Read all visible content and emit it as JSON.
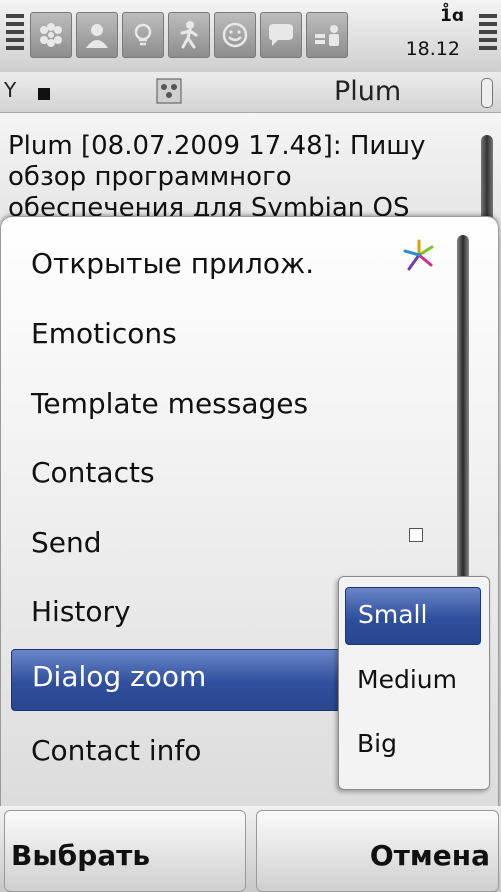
{
  "status": {
    "net_indicator": "1̊ɑ",
    "clock": "18.12",
    "tab_icons": [
      "contacts-group-icon",
      "person-icon",
      "lightbulb-icon",
      "running-person-icon",
      "smiley-icon",
      "speech-bubble-icon",
      "user-card-icon"
    ]
  },
  "titlebar": {
    "title": "Plum"
  },
  "chat": {
    "message": "Plum [08.07.2009 17.48]: Пишу обзор программного обеспечения для Symbian OS"
  },
  "menu": {
    "items": [
      {
        "label": "Открытые прилож."
      },
      {
        "label": "Emoticons"
      },
      {
        "label": "Template messages"
      },
      {
        "label": "Contacts"
      },
      {
        "label": "Send"
      },
      {
        "label": "History"
      },
      {
        "label": "Dialog zoom"
      },
      {
        "label": "Contact info"
      }
    ]
  },
  "submenu": {
    "items": [
      {
        "label": "Small"
      },
      {
        "label": "Medium"
      },
      {
        "label": "Big"
      }
    ]
  },
  "softkeys": {
    "left": "Выбрать",
    "right": "Отмена"
  },
  "colors": {
    "highlight": "#2f4f9d",
    "menu_bg": "#ffffff"
  }
}
